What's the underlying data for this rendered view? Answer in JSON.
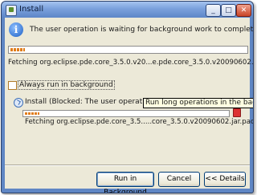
{
  "window": {
    "title": "Install",
    "controls": {
      "minimize": "_",
      "maximize": "□",
      "close": "✕"
    }
  },
  "message": "The user operation is waiting for background work to complete.",
  "main_progress": {
    "fraction": 0.06
  },
  "fetching_text": "Fetching org.eclipse.pde.core_3.5.0.v20...e.pde.core_3.5.0.v20090602.jar.pack.gz",
  "always_background": {
    "label": "Always run in background",
    "checked": false
  },
  "job": {
    "label": "Install (Blocked: The user operation....ng for",
    "progress_fraction": 0.07,
    "detail": "Fetching org.eclipse.pde.core_3.5.....core_3.5.0.v20090602.jar.pack.gz"
  },
  "tooltip": "Run long operations in the background w",
  "buttons": {
    "run_background": "Run in Background",
    "cancel": "Cancel",
    "details": "<< Details"
  },
  "colors": {
    "accent": "#e07c1a",
    "title_bar": "#7aa0dc",
    "dialog_bg": "#ece9d8"
  }
}
